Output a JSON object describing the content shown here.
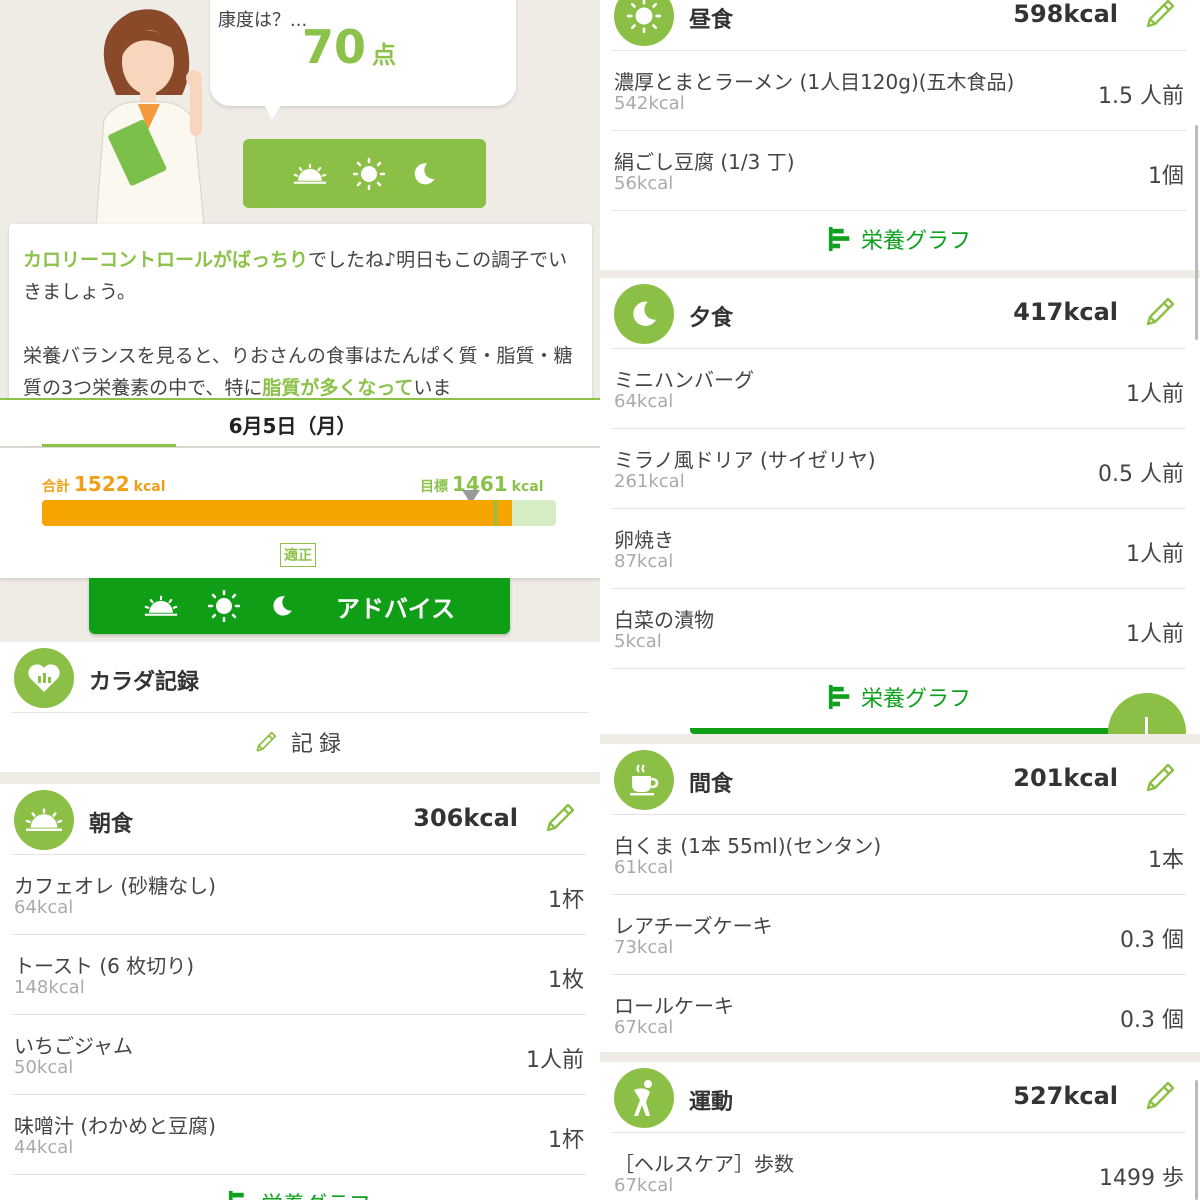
{
  "advice": {
    "question": "康度は？...",
    "score": "70",
    "score_unit": "点",
    "message_highlight_1": "カロリーコントロールがばっちり",
    "message_part_1": "でしたね♪明日もこの調子でいきましょう。",
    "message_part_2": "栄養バランスを見ると、りおさんの食事はたんぱく質・脂質・糖質の3つ栄養素の中で、特に",
    "message_highlight_2": "脂質が多くなって",
    "message_part_3": "いま"
  },
  "date": "6月5日（月）",
  "calories": {
    "total_label": "合計",
    "total_value": "1522",
    "target_label": "目標",
    "target_value": "1461",
    "unit": "kcal",
    "status": "適正",
    "fill_fraction": 0.915
  },
  "advice_button_label": "アドバイス",
  "body_record": {
    "title": "カラダ記録",
    "record_label": "記録"
  },
  "graph_label": "栄養グラフ",
  "breakfast": {
    "title": "朝食",
    "kcal": "306kcal",
    "items": [
      {
        "name": "カフェオレ (砂糖なし)",
        "kcal": "64kcal",
        "amount": "1杯"
      },
      {
        "name": "トースト (6 枚切り)",
        "kcal": "148kcal",
        "amount": "1枚"
      },
      {
        "name": "いちごジャム",
        "kcal": "50kcal",
        "amount": "1人前"
      },
      {
        "name": "味噌汁 (わかめと豆腐)",
        "kcal": "44kcal",
        "amount": "1杯"
      }
    ]
  },
  "lunch": {
    "title": "昼食",
    "kcal": "598kcal",
    "items": [
      {
        "name": "濃厚とまとラーメン (1人目120g)(五木食品)",
        "kcal": "542kcal",
        "amount": "1.5 人前"
      },
      {
        "name": "絹ごし豆腐 (1/3 丁)",
        "kcal": "56kcal",
        "amount": "1個"
      }
    ]
  },
  "dinner": {
    "title": "夕食",
    "kcal": "417kcal",
    "items": [
      {
        "name": "ミニハンバーグ",
        "kcal": "64kcal",
        "amount": "1人前"
      },
      {
        "name": "ミラノ風ドリア (サイゼリヤ)",
        "kcal": "261kcal",
        "amount": "0.5 人前"
      },
      {
        "name": "卵焼き",
        "kcal": "87kcal",
        "amount": "1人前"
      },
      {
        "name": "白菜の漬物",
        "kcal": "5kcal",
        "amount": "1人前"
      }
    ]
  },
  "snack": {
    "title": "間食",
    "kcal": "201kcal",
    "items": [
      {
        "name": "白くま (1本 55ml)(センタン)",
        "kcal": "61kcal",
        "amount": "1本"
      },
      {
        "name": "レアチーズケーキ",
        "kcal": "73kcal",
        "amount": "0.3 個"
      },
      {
        "name": "ロールケーキ",
        "kcal": "67kcal",
        "amount": "0.3 個"
      }
    ]
  },
  "exercise": {
    "title": "運動",
    "kcal": "527kcal",
    "items": [
      {
        "name": "［ヘルスケア］歩数",
        "kcal": "67kcal",
        "amount": "1499 歩"
      }
    ]
  },
  "colors": {
    "accent": "#8bbf45",
    "deep_green": "#0f9e16",
    "orange": "#f5a400",
    "background": "#efece6"
  },
  "icons": [
    "sunrise-icon",
    "sun-icon",
    "moon-icon",
    "heart-chart-icon",
    "pencil-icon",
    "bar-graph-icon",
    "coffee-cup-icon",
    "stretch-person-icon",
    "plus-icon"
  ]
}
